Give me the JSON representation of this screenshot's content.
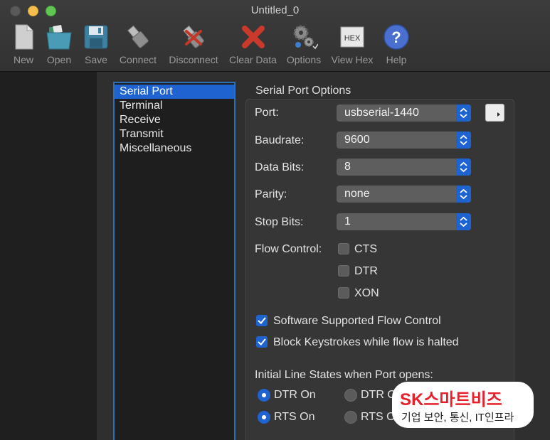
{
  "window": {
    "title": "Untitled_0"
  },
  "toolbar": {
    "items": [
      {
        "label": "New",
        "icon": "new-file-icon"
      },
      {
        "label": "Open",
        "icon": "folder-icon"
      },
      {
        "label": "Save",
        "icon": "floppy-disk-icon"
      },
      {
        "label": "Connect",
        "icon": "usb-plug-icon"
      },
      {
        "label": "Disconnect",
        "icon": "usb-disconnect-icon"
      },
      {
        "label": "Clear Data",
        "icon": "red-x-icon"
      },
      {
        "label": "Options",
        "icon": "gears-icon"
      },
      {
        "label": "View Hex",
        "icon": "hex-icon"
      },
      {
        "label": "Help",
        "icon": "question-icon"
      }
    ],
    "hex_text": "HEX",
    "help_glyph": "?"
  },
  "sidebar": {
    "items": [
      {
        "label": "Serial Port",
        "selected": true
      },
      {
        "label": "Terminal",
        "selected": false
      },
      {
        "label": "Receive",
        "selected": false
      },
      {
        "label": "Transmit",
        "selected": false
      },
      {
        "label": "Miscellaneous",
        "selected": false
      }
    ]
  },
  "options": {
    "section_title": "Serial Port Options",
    "port_label": "Port:",
    "port_value": "usbserial-1440",
    "baudrate_label": "Baudrate:",
    "baudrate_value": "9600",
    "databits_label": "Data Bits:",
    "databits_value": "8",
    "parity_label": "Parity:",
    "parity_value": "none",
    "stopbits_label": "Stop Bits:",
    "stopbits_value": "1",
    "flow_control_label": "Flow Control:",
    "flow_cts": "CTS",
    "flow_dtr": "DTR",
    "flow_xon": "XON",
    "software_flow_label": "Software Supported Flow Control",
    "block_keystrokes_label": "Block Keystrokes while flow is halted",
    "initial_states_label": "Initial Line States when Port opens:",
    "dtr_on": "DTR On",
    "dtr_off_partial": "DTR O",
    "rts_on": "RTS On",
    "rts_off_partial": "RTS O"
  },
  "watermark": {
    "line1_latin": "SK",
    "line1_korean": "스마트비즈",
    "line2": "기업 보안, 통신, IT인프라"
  },
  "colors": {
    "accent": "#1e63d0",
    "watermark_red": "#e6212b"
  }
}
